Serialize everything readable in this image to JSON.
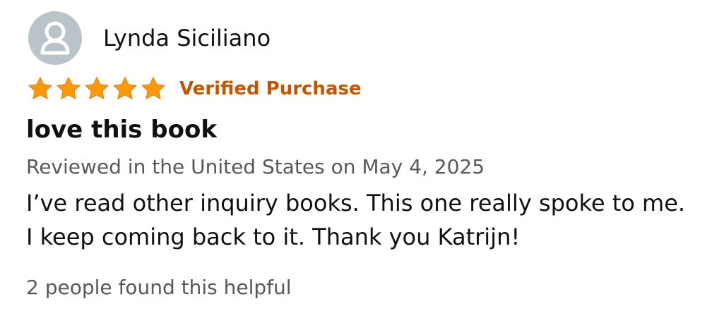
{
  "reviewer": {
    "name": "Lynda Siciliano",
    "avatar_icon": "default-user-avatar-icon"
  },
  "rating": {
    "stars": 5,
    "max_stars": 5,
    "star_color": "#ff9900",
    "verified_label": "Verified Purchase",
    "verified_color": "#c45500"
  },
  "review": {
    "title": "love this book",
    "meta": "Reviewed in the United States on May 4, 2025",
    "body": "I’ve read other inquiry books. This one really spoke to me. I keep coming back to it. Thank you Katrijn!",
    "helpful": "2 people found this helpful"
  }
}
